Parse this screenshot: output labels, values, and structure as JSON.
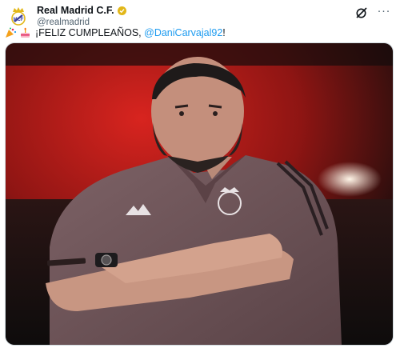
{
  "author": {
    "display_name": "Real Madrid C.F.",
    "handle": "@realmadrid",
    "avatar_icon": "real-madrid-crest-icon",
    "verified_icon": "gold-verified-badge-icon",
    "verified_color": "#e2b719"
  },
  "actions": {
    "grok_icon": "grok-icon",
    "more_label": "···"
  },
  "tweet": {
    "emoji_1": "party-popper-emoji",
    "emoji_2": "birthday-cake-emoji",
    "text_prefix": "¡FELIZ CUMPLEAÑOS, ",
    "mention": "@DaniCarvajal92",
    "text_suffix": "!"
  },
  "media": {
    "type": "photo",
    "accent_color": "#c8201e",
    "shirt_color": "#6e5559"
  }
}
